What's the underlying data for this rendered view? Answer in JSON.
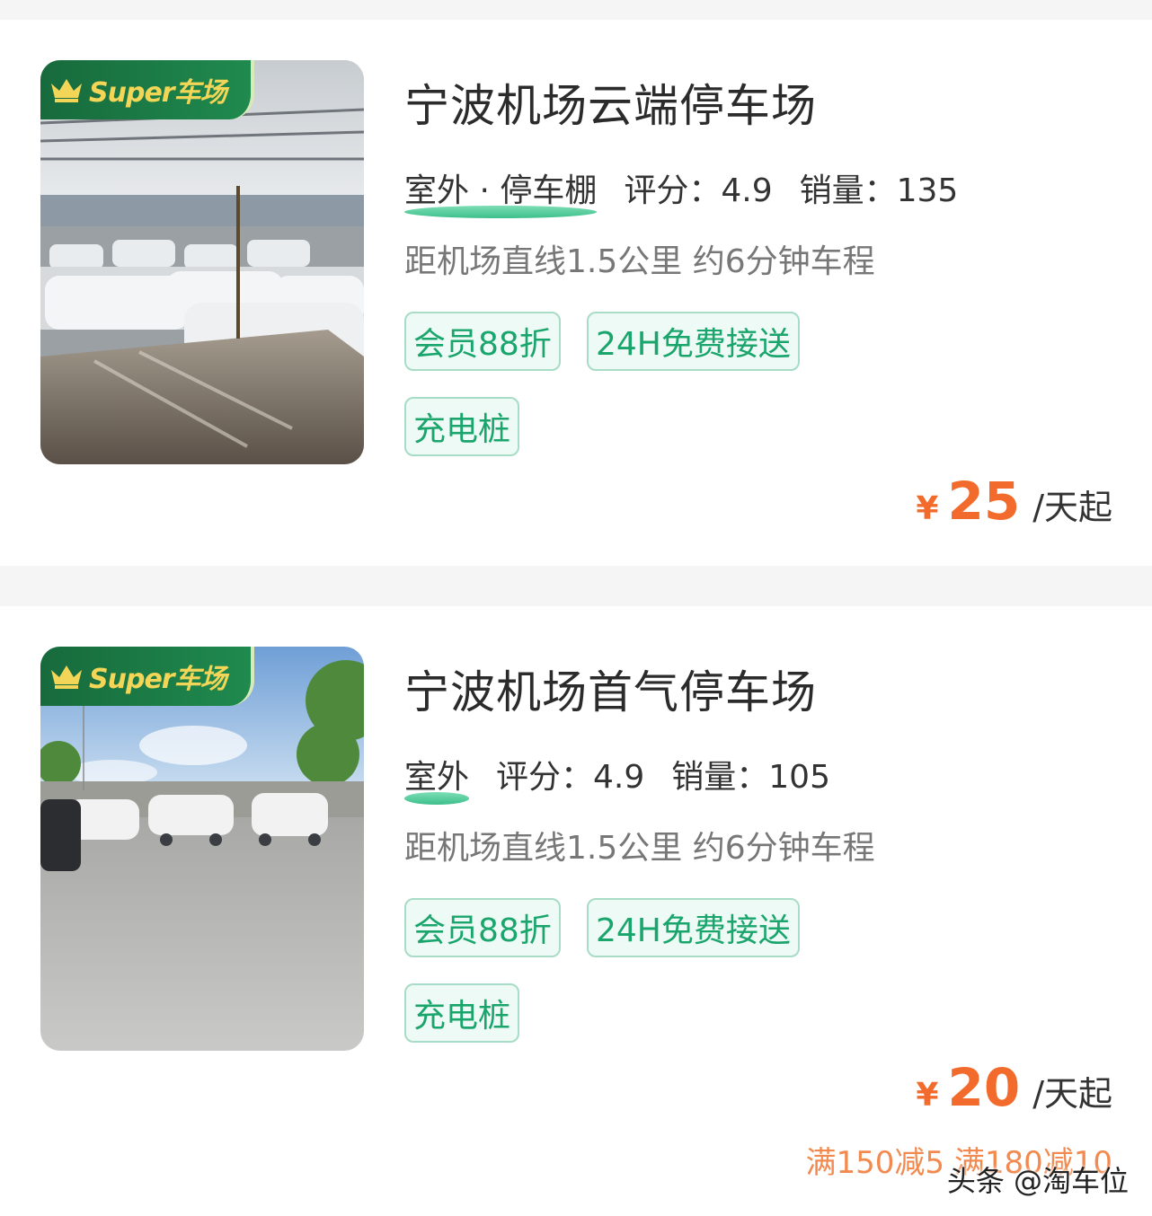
{
  "listings": [
    {
      "name": "宁波机场云端停车场",
      "environment": "室外 · 停车棚",
      "rating": "评分：4.9",
      "sales": "销量：135",
      "distance": "距机场直线1.5公里 约6分钟车程",
      "tags": [
        "会员88折",
        "24H免费接送",
        "充电桩"
      ],
      "price_symbol": "¥",
      "price": "25",
      "price_unit": "/天起",
      "badge": "Super车场"
    },
    {
      "name": "宁波机场首气停车场",
      "environment": "室外",
      "rating": "评分：4.9",
      "sales": "销量：105",
      "distance": "距机场直线1.5公里 约6分钟车程",
      "tags": [
        "会员88折",
        "24H免费接送",
        "充电桩"
      ],
      "price_symbol": "¥",
      "price": "20",
      "price_unit": "/天起",
      "promo": "满150减5 满180减10",
      "badge": "Super车场"
    }
  ],
  "watermark": "头条 @淘车位",
  "colors": {
    "accent_green": "#1aa56d",
    "tag_border": "#a8dcc6",
    "price_orange": "#f26b2c",
    "badge_green": "#176a3c",
    "badge_text": "#f3d657"
  }
}
